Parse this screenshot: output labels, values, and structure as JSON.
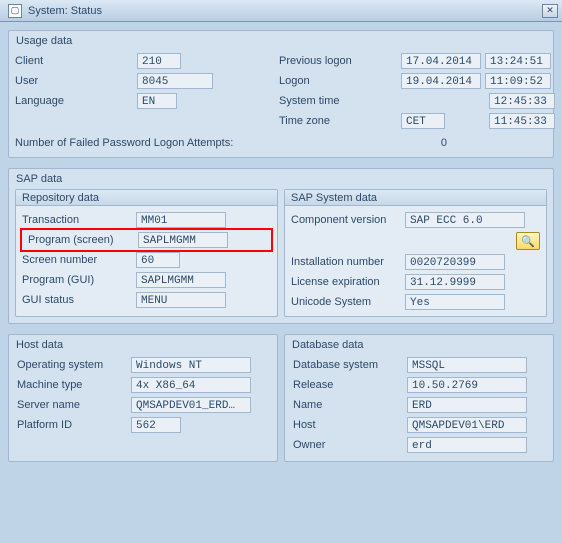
{
  "window": {
    "title": "System: Status"
  },
  "usage": {
    "group_title": "Usage data",
    "client_label": "Client",
    "client_value": "210",
    "user_label": "User",
    "user_value": "8045",
    "language_label": "Language",
    "language_value": "EN",
    "prevlogon_label": "Previous logon",
    "prevlogon_date": "17.04.2014",
    "prevlogon_time": "13:24:51",
    "logon_label": "Logon",
    "logon_date": "19.04.2014",
    "logon_time": "11:09:52",
    "systime_label": "System time",
    "systime_value": "12:45:33",
    "timezone_label": "Time zone",
    "timezone_zone": "CET",
    "timezone_time": "11:45:33",
    "attempts_label": "Number of Failed Password Logon Attempts:",
    "attempts_value": "0"
  },
  "sap": {
    "group_title": "SAP data",
    "repo": {
      "title": "Repository data",
      "transaction_label": "Transaction",
      "transaction_value": "MM01",
      "program_screen_label": "Program (screen)",
      "program_screen_value": "SAPLMGMM",
      "screen_number_label": "Screen number",
      "screen_number_value": "60",
      "program_gui_label": "Program (GUI)",
      "program_gui_value": "SAPLMGMM",
      "gui_status_label": "GUI status",
      "gui_status_value": "MENU"
    },
    "system": {
      "title": "SAP System data",
      "component_label": "Component version",
      "component_value": "SAP ECC 6.0",
      "install_label": "Installation number",
      "install_value": "0020720399",
      "license_label": "License expiration",
      "license_value": "31.12.9999",
      "unicode_label": "Unicode System",
      "unicode_value": "Yes"
    }
  },
  "host": {
    "group_title": "Host data",
    "os_label": "Operating system",
    "os_value": "Windows NT",
    "machine_label": "Machine type",
    "machine_value": "4x X86_64",
    "server_label": "Server name",
    "server_value": "QMSAPDEV01_ERD…",
    "platform_label": "Platform ID",
    "platform_value": "562"
  },
  "db": {
    "group_title": "Database data",
    "system_label": "Database system",
    "system_value": "MSSQL",
    "release_label": "Release",
    "release_value": "10.50.2769",
    "name_label": "Name",
    "name_value": "ERD",
    "host_label": "Host",
    "host_value": "QMSAPDEV01\\ERD",
    "owner_label": "Owner",
    "owner_value": "erd"
  }
}
